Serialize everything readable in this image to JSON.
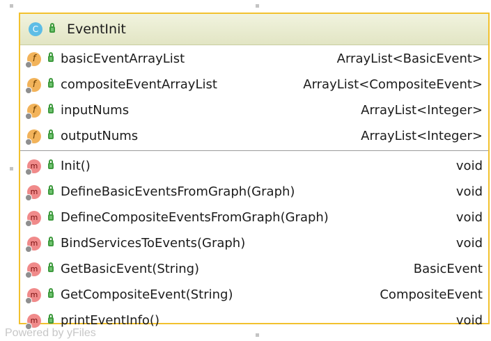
{
  "class": {
    "badge": "C",
    "name": "EventInit",
    "fields": [
      {
        "name": "basicEventArrayList",
        "type": "ArrayList<BasicEvent>"
      },
      {
        "name": "compositeEventArrayList",
        "type": "ArrayList<CompositeEvent>"
      },
      {
        "name": "inputNums",
        "type": "ArrayList<Integer>"
      },
      {
        "name": "outputNums",
        "type": "ArrayList<Integer>"
      }
    ],
    "methods": [
      {
        "name": "Init()",
        "type": "void"
      },
      {
        "name": "DefineBasicEventsFromGraph(Graph)",
        "type": "void"
      },
      {
        "name": "DefineCompositeEventsFromGraph(Graph)",
        "type": "void"
      },
      {
        "name": "BindServicesToEvents(Graph)",
        "type": "void"
      },
      {
        "name": "GetBasicEvent(String)",
        "type": "BasicEvent"
      },
      {
        "name": "GetCompositeEvent(String)",
        "type": "CompositeEvent"
      },
      {
        "name": "printEventInfo()",
        "type": "void"
      }
    ]
  },
  "icons": {
    "field_badge": "f",
    "method_badge": "m",
    "field": "field-icon",
    "method": "method-icon",
    "visibility": "public-lock-icon"
  },
  "colors": {
    "border": "#f2c12e",
    "header": "#e2e5c4",
    "class_badge": "#5dbde6",
    "field_badge": "#f2b35a",
    "method_badge": "#f08a8a",
    "lock": "#3e9a3e"
  },
  "watermark": "Powered by yFiles"
}
